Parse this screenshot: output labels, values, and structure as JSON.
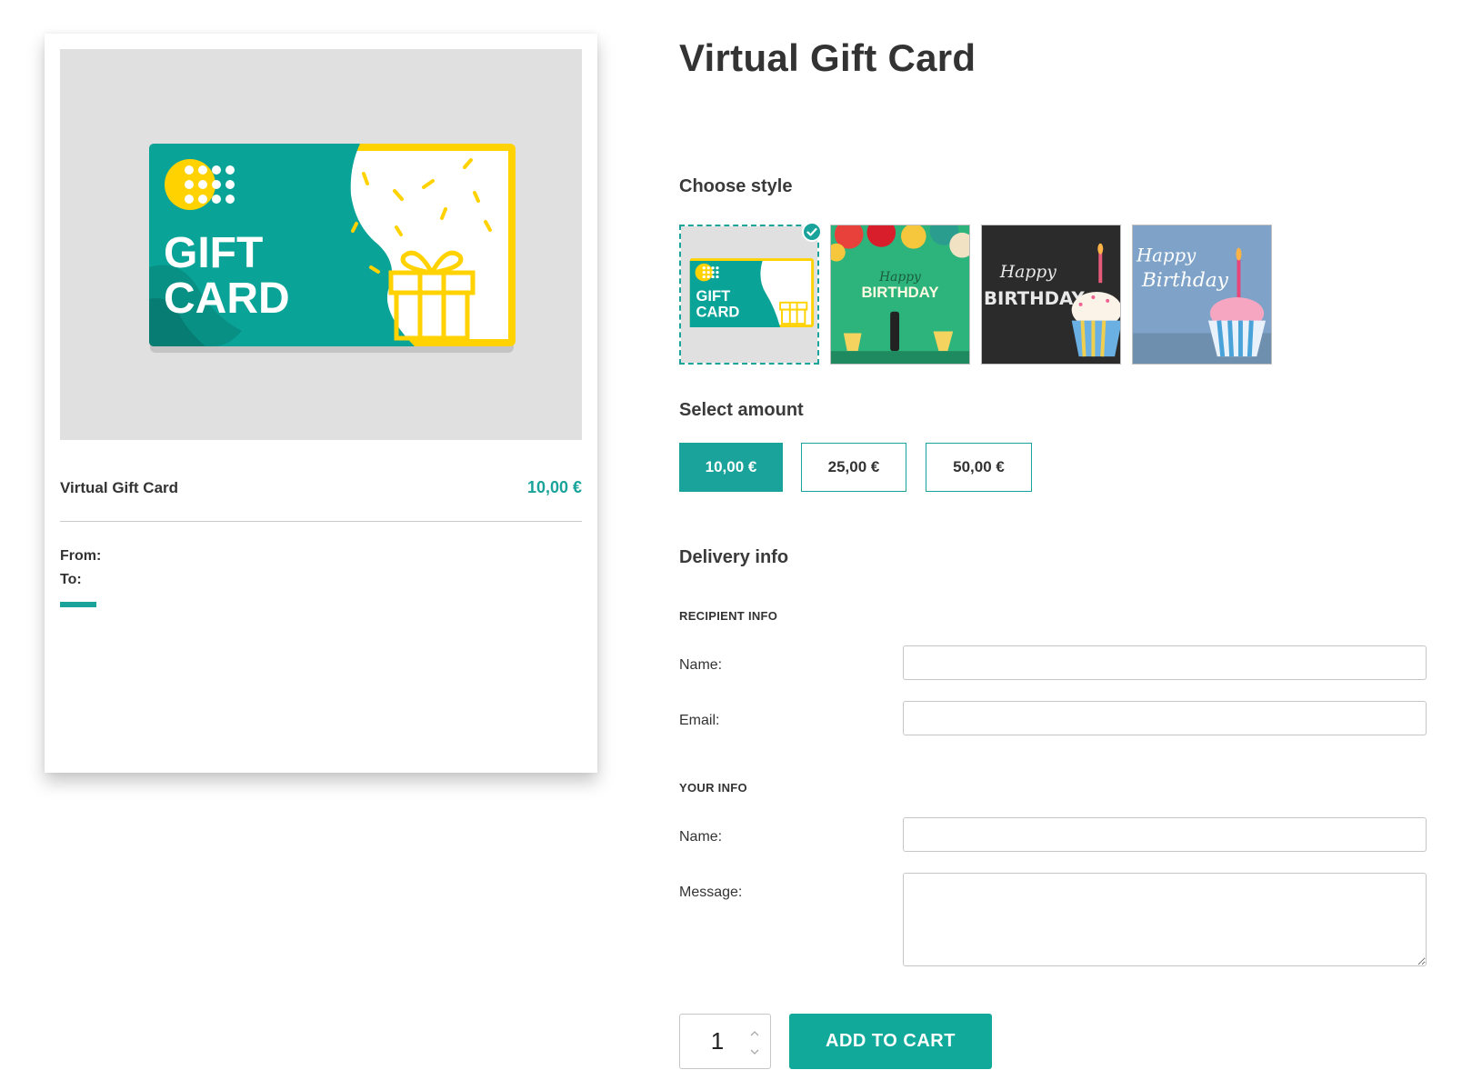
{
  "preview": {
    "card_line1": "GIFT",
    "card_line2": "CARD",
    "title": "Virtual Gift Card",
    "price": "10,00 €",
    "from_label": "From:",
    "to_label": "To:"
  },
  "product": {
    "title": "Virtual Gift Card"
  },
  "choose_style": {
    "label": "Choose style",
    "options": [
      {
        "name": "gift-card",
        "line1": "GIFT",
        "line2": "CARD",
        "selected": true
      },
      {
        "name": "birthday-balloons",
        "line1": "Happy",
        "line2": "BIRTHDAY",
        "selected": false
      },
      {
        "name": "birthday-chalkboard",
        "line1": "Happy",
        "line2": "BIRTHDAY",
        "selected": false
      },
      {
        "name": "birthday-cupcake",
        "line1": "Happy",
        "line2": "Birthday",
        "selected": false
      }
    ]
  },
  "select_amount": {
    "label": "Select amount",
    "options": [
      "10,00 €",
      "25,00 €",
      "50,00 €"
    ],
    "selected_index": 0
  },
  "delivery": {
    "label": "Delivery info",
    "recipient_heading": "RECIPIENT INFO",
    "recipient_name_label": "Name:",
    "recipient_name_value": "",
    "recipient_email_label": "Email:",
    "recipient_email_value": "",
    "your_heading": "YOUR INFO",
    "your_name_label": "Name:",
    "your_name_value": "",
    "message_label": "Message:",
    "message_value": ""
  },
  "cart": {
    "quantity": "1",
    "add_label": "ADD TO CART"
  },
  "colors": {
    "accent": "#19a39a",
    "card_teal": "#0aa398",
    "card_yellow": "#ffd200",
    "button": "#11a99a"
  }
}
